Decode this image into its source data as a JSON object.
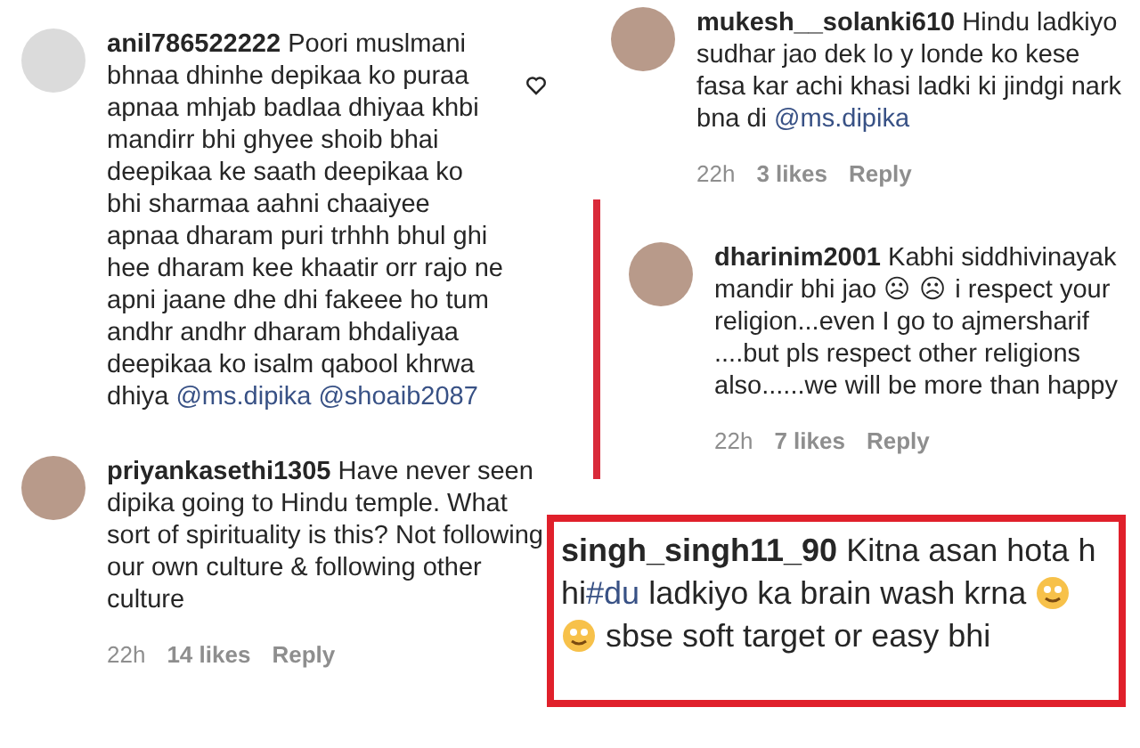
{
  "left_column": [
    {
      "username": "anil786522222",
      "avatar_photo": false,
      "liked": false,
      "parts": [
        {
          "kind": "text",
          "text": "Poori muslmani bhnaa dhinhe depikaa ko puraa apnaa mhjab badlaa dhiyaa khbi mandirr bhi ghyee shoib bhai deepikaa ke saath deepikaa ko bhi sharmaa aahni chaaiyee apnaa dharam puri trhhh bhul ghi hee dharam kee khaatir orr rajo ne apni jaane dhe dhi fakeee ho tum andhr andhr dharam bhdaliyaa deepikaa ko isalm qabool khrwa dhiya "
        },
        {
          "kind": "mention",
          "text": "@ms.dipika"
        },
        {
          "kind": "mention",
          "text": "@shoaib2087"
        }
      ]
    },
    {
      "username": "priyankasethi1305",
      "avatar_photo": true,
      "parts": [
        {
          "kind": "text",
          "text": "Have never seen dipika going to Hindu temple. What sort of spirituality is this? Not following our own culture & following other culture"
        }
      ],
      "time": "22h",
      "likes": "14 likes",
      "reply": "Reply"
    }
  ],
  "right_column": [
    {
      "username": "mukesh__solanki610",
      "avatar_photo": true,
      "parts": [
        {
          "kind": "text",
          "text": "Hindu ladkiyo sudhar jao dek lo y londe ko kese fasa kar achi khasi ladki ki jindgi nark bna di "
        },
        {
          "kind": "mention",
          "text": "@ms.dipika"
        }
      ],
      "time": "22h",
      "likes": "3 likes",
      "reply": "Reply"
    },
    {
      "username": "dharinim2001",
      "avatar_photo": true,
      "is_reply": true,
      "parts": [
        {
          "kind": "text",
          "text": "Kabhi siddhivinayak mandir bhi jao ☹ ☹ i respect your religion...even I go to ajmersharif ....but pls respect other religions also......we will be more than happy"
        }
      ],
      "time": "22h",
      "likes": "7 likes",
      "reply": "Reply"
    },
    {
      "username": "singh_singh11_90",
      "highlighted": true,
      "parts": [
        {
          "kind": "text",
          "text": "Kitna asan hota h hi"
        },
        {
          "kind": "mention",
          "text": "#du"
        },
        {
          "kind": "text",
          "text": " ladkiyo ka brain wash krna "
        },
        {
          "kind": "emoji"
        },
        {
          "kind": "emoji"
        },
        {
          "kind": "text",
          "text": " sbse soft target or easy bhi"
        }
      ]
    }
  ]
}
